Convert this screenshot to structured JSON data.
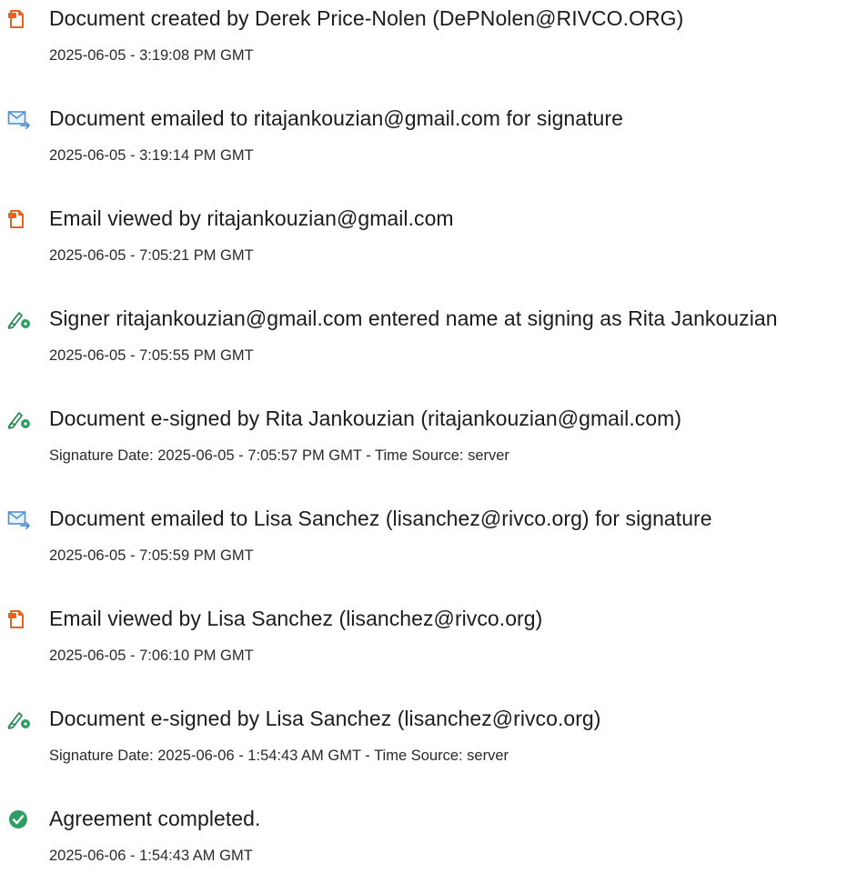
{
  "colors": {
    "doc_icon": "#e8631f",
    "email_icon": "#4a90d9",
    "sign_icon_pen": "#2e8b57",
    "sign_icon_dot": "#2f9e62",
    "complete_icon": "#2f9e62",
    "text": "#1c1c1c"
  },
  "events": [
    {
      "icon": "document-icon",
      "title": "Document created by Derek Price-Nolen (DePNolen@RIVCO.ORG)",
      "sub": "2025-06-05 - 3:19:08 PM GMT"
    },
    {
      "icon": "email-send-icon",
      "title": "Document emailed to ritajankouzian@gmail.com for signature",
      "sub": "2025-06-05 - 3:19:14 PM GMT"
    },
    {
      "icon": "document-icon",
      "title": "Email viewed by ritajankouzian@gmail.com",
      "sub": "2025-06-05 - 7:05:21 PM GMT"
    },
    {
      "icon": "pen-sign-icon",
      "title": "Signer ritajankouzian@gmail.com entered name at signing as Rita Jankouzian",
      "sub": "2025-06-05 - 7:05:55 PM GMT"
    },
    {
      "icon": "pen-sign-icon",
      "title": "Document e-signed by Rita Jankouzian (ritajankouzian@gmail.com)",
      "sub": "Signature Date: 2025-06-05 - 7:05:57 PM GMT - Time Source: server"
    },
    {
      "icon": "email-send-icon",
      "title": "Document emailed to Lisa Sanchez (lisanchez@rivco.org) for signature",
      "sub": "2025-06-05 - 7:05:59 PM GMT"
    },
    {
      "icon": "document-icon",
      "title": "Email viewed by Lisa Sanchez (lisanchez@rivco.org)",
      "sub": "2025-06-05 - 7:06:10 PM GMT"
    },
    {
      "icon": "pen-sign-icon",
      "title": "Document e-signed by Lisa Sanchez (lisanchez@rivco.org)",
      "sub": "Signature Date: 2025-06-06 - 1:54:43 AM GMT - Time Source: server"
    },
    {
      "icon": "checkmark-circle-icon",
      "title": "Agreement completed.",
      "sub": "2025-06-06 - 1:54:43 AM GMT"
    }
  ]
}
